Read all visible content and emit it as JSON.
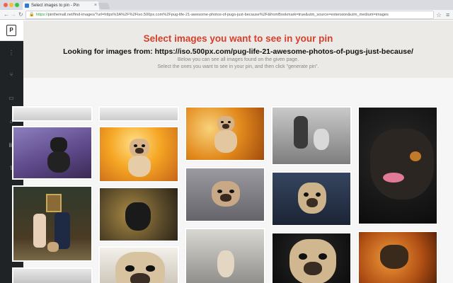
{
  "browser": {
    "tab_title": "Select images to pin - Pin",
    "tab_close": "×",
    "url_scheme": "https://",
    "url_rest": "pinthemall.net/find-images/?url=https%3A%2F%2Fiso.500px.com%2Fpug-life-21-awesome-photos-of-pugs-just-because%2F&fromBookmark=true&utm_source=extension&utm_medium=images",
    "back_icon": "←",
    "forward_icon": "→",
    "reload_icon": "↻",
    "lock_icon": "🔒",
    "star_icon": "☆",
    "menu_icon": "≡"
  },
  "app": {
    "logo_text": "P",
    "sidebar_icons": [
      "more-icon",
      "sitemap-icon",
      "monitor-icon",
      "home-icon",
      "bookmark-icon",
      "upload-icon"
    ],
    "sidebar_glyphs": [
      "⋮",
      "⑂",
      "▭",
      "⌂",
      "▤",
      "⇪"
    ]
  },
  "header": {
    "title": "Select images you want to see in your pin",
    "subtitle": "Looking for images from: https://iso.500px.com/pug-life-21-awesome-photos-of-pugs-just-because/",
    "line1": "Below you can see all images found on the given page.",
    "line2": "Select the ones you want to see in your pin, and then click \"generate pin\"."
  },
  "colors": {
    "accent": "#d6402b",
    "sidebar": "#1f2326",
    "header_bg": "#eceae6"
  }
}
